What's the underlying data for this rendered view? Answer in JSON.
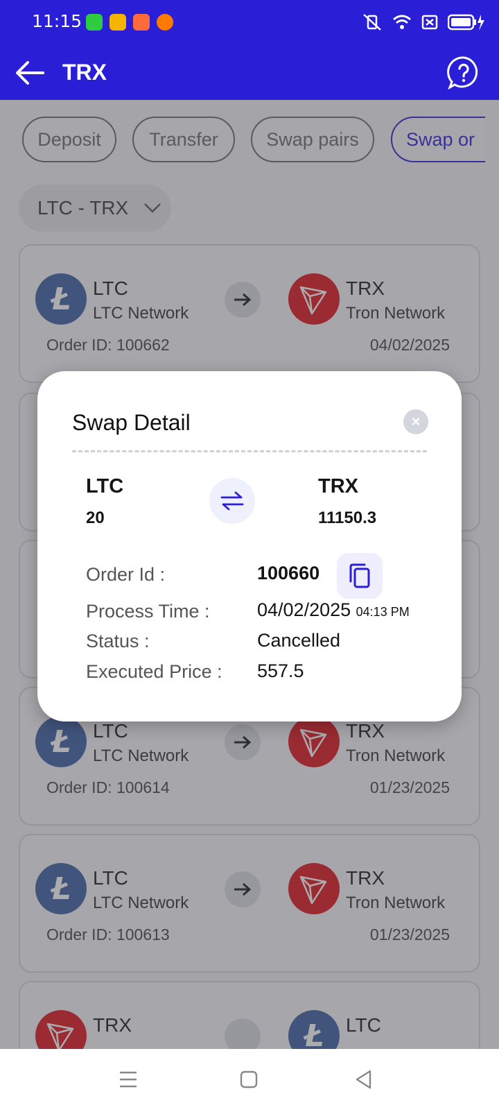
{
  "status_bar": {
    "time": "11:15"
  },
  "app_bar": {
    "title": "TRX"
  },
  "tabs": [
    {
      "label": "Deposit"
    },
    {
      "label": "Transfer"
    },
    {
      "label": "Swap pairs"
    },
    {
      "label": "Swap or"
    }
  ],
  "pair_selector": {
    "value": "LTC - TRX"
  },
  "orders": [
    {
      "from": "LTC",
      "from_network": "LTC Network",
      "to": "TRX",
      "to_network": "Tron Network",
      "order_id": "Order ID: 100662",
      "date": "04/02/2025"
    },
    {
      "from": "LTC",
      "from_network": "LTC Network",
      "to": "TRX",
      "to_network": "Tron Network",
      "order_id": "Order ID: 100614",
      "date": "01/23/2025"
    },
    {
      "from": "LTC",
      "from_network": "LTC Network",
      "to": "TRX",
      "to_network": "Tron Network",
      "order_id": "Order ID: 100613",
      "date": "01/23/2025"
    },
    {
      "from": "TRX",
      "to": "LTC"
    }
  ],
  "swap_detail": {
    "title": "Swap Detail",
    "close_label": "×",
    "from_symbol": "LTC",
    "from_amount": "20",
    "to_symbol": "TRX",
    "to_amount": "11150.3",
    "order_id_label": "Order Id :",
    "order_id": "100660",
    "process_time_label": "Process Time :",
    "process_date": "04/02/2025",
    "process_time": "04:13 PM",
    "status_label": "Status :",
    "status": "Cancelled",
    "executed_price_label": "Executed Price :",
    "executed_price": "557.5"
  },
  "colors": {
    "primary": "#2a1fd6",
    "ltc": "#3d5fa3",
    "trx": "#e0141d"
  }
}
